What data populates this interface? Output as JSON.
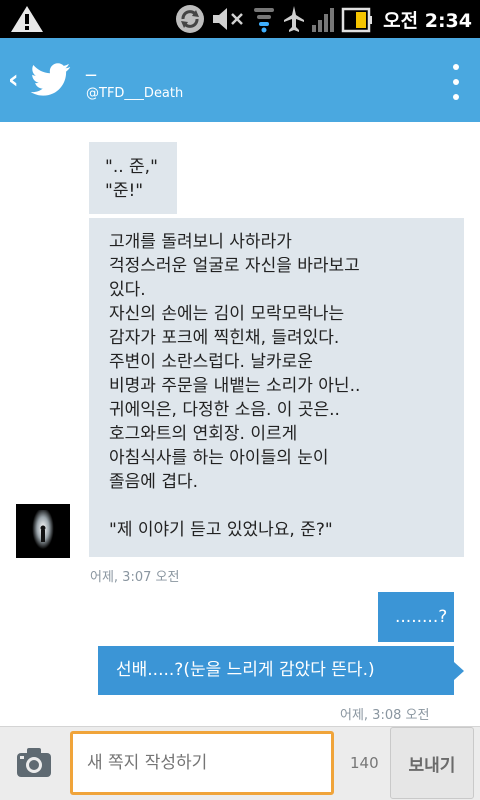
{
  "status_bar": {
    "time": "오전 2:34",
    "icons": [
      "warning-icon",
      "sync-icon",
      "mute-icon",
      "wifi-icon",
      "airplane-icon",
      "signal-icon",
      "battery-icon"
    ]
  },
  "header": {
    "back_glyph": "‹",
    "name": "_",
    "handle": "@TFD___Death",
    "accent_color": "#4aa8e0"
  },
  "messages": [
    {
      "direction": "in",
      "text": "\".. 준,\"\n\"준!\""
    },
    {
      "direction": "in",
      "text": "고개를 돌려보니 사하라가\n걱정스러운 얼굴로 자신을 바라보고\n있다.\n자신의 손에는 김이 모락모락나는\n감자가 포크에 찍힌채, 들려있다.\n주변이 소란스럽다. 날카로운\n비명과 주문을 내뱉는 소리가 아닌..\n귀에익은, 다정한 소음. 이 곳은..\n호그와트의 연회장. 이르게\n아침식사를 하는 아이들의 눈이\n졸음에 겹다.\n\n\"제 이야기 듣고 있었나요, 준?\""
    },
    {
      "direction": "in_timestamp",
      "text": "어제, 3:07 오전"
    },
    {
      "direction": "out",
      "text": "........?"
    },
    {
      "direction": "out",
      "text": "선배.....?(눈을 느리게 감았다 뜬다.)"
    },
    {
      "direction": "out_timestamp",
      "text": "어제, 3:08 오전"
    }
  ],
  "composer": {
    "placeholder": "새 쪽지 작성하기",
    "char_count": "140",
    "send_label": "보내기",
    "focus_color": "#f0a43a"
  }
}
